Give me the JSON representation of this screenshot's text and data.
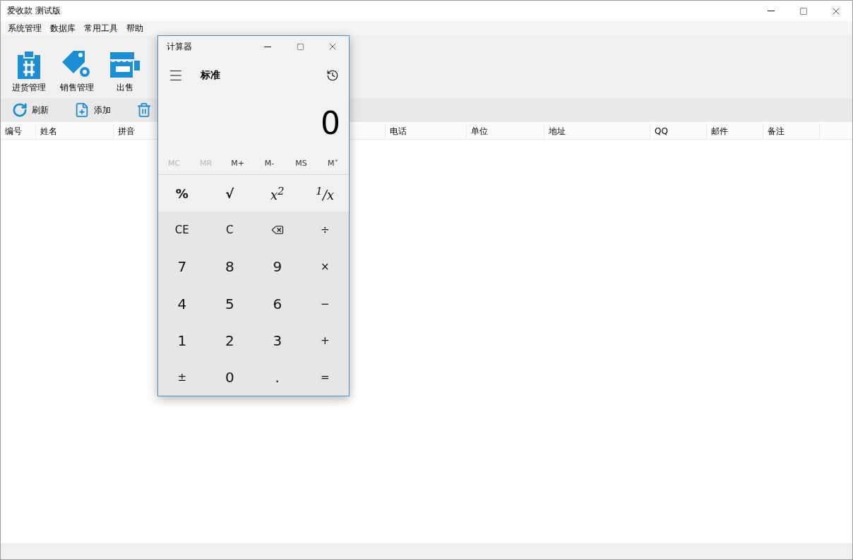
{
  "window": {
    "title": "爱收款 测试版"
  },
  "menu": [
    "系统管理",
    "数据库",
    "常用工具",
    "帮助"
  ],
  "big_toolbar": [
    {
      "label": "进货管理",
      "kind": "purchase"
    },
    {
      "label": "销售管理",
      "kind": "sales"
    },
    {
      "label": "出售",
      "kind": "shop"
    }
  ],
  "small_toolbar": [
    {
      "label": "刷新",
      "kind": "refresh"
    },
    {
      "label": "添加",
      "kind": "add"
    },
    {
      "kind": "delete"
    }
  ],
  "table": {
    "columns": [
      "编号",
      "姓名",
      "拼音",
      "电话",
      "单位",
      "地址",
      "QQ",
      "邮件",
      "备注"
    ]
  },
  "calculator": {
    "title": "计算器",
    "mode": "标准",
    "display": "0",
    "memory": [
      {
        "label": "MC",
        "disabled": true
      },
      {
        "label": "MR",
        "disabled": true
      },
      {
        "label": "M+",
        "disabled": false
      },
      {
        "label": "M-",
        "disabled": false
      },
      {
        "label": "MS",
        "disabled": false
      },
      {
        "label": "M˅",
        "disabled": false
      }
    ],
    "keys": [
      {
        "label": "%",
        "kind": "func"
      },
      {
        "label": "√",
        "kind": "func"
      },
      {
        "label": "x$^{2}$",
        "kind": "math"
      },
      {
        "label": "$^{1}$/x",
        "kind": "math"
      },
      {
        "label": "CE",
        "kind": "op"
      },
      {
        "label": "C",
        "kind": "op"
      },
      {
        "kind": "backspace"
      },
      {
        "label": "÷",
        "kind": "op"
      },
      {
        "label": "7",
        "kind": "digit"
      },
      {
        "label": "8",
        "kind": "digit"
      },
      {
        "label": "9",
        "kind": "digit"
      },
      {
        "label": "×",
        "kind": "op"
      },
      {
        "label": "4",
        "kind": "digit"
      },
      {
        "label": "5",
        "kind": "digit"
      },
      {
        "label": "6",
        "kind": "digit"
      },
      {
        "label": "−",
        "kind": "op"
      },
      {
        "label": "1",
        "kind": "digit"
      },
      {
        "label": "2",
        "kind": "digit"
      },
      {
        "label": "3",
        "kind": "digit"
      },
      {
        "label": "+",
        "kind": "op"
      },
      {
        "label": "±",
        "kind": "op"
      },
      {
        "label": "0",
        "kind": "digit"
      },
      {
        "label": ".",
        "kind": "digit"
      },
      {
        "label": "=",
        "kind": "op"
      }
    ]
  }
}
